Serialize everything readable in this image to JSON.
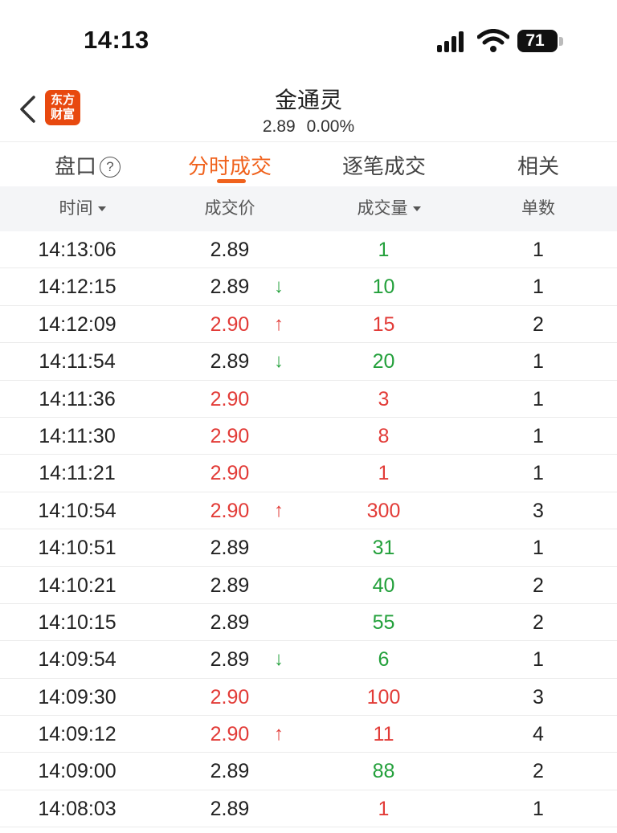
{
  "status_bar": {
    "time": "14:13",
    "battery": "71"
  },
  "header": {
    "stock_name": "金通灵",
    "price": "2.89",
    "change_pct": "0.00%",
    "logo_line1": "东方",
    "logo_line2": "财富"
  },
  "tabs": [
    {
      "label": "盘口",
      "active": false
    },
    {
      "label": "分时成交",
      "active": true
    },
    {
      "label": "逐笔成交",
      "active": false
    },
    {
      "label": "相关",
      "active": false
    }
  ],
  "columns": [
    "时间",
    "成交价",
    "成交量",
    "单数"
  ],
  "colors": {
    "up": "#e23b37",
    "down": "#23a03b",
    "accent": "#f0621d"
  },
  "trades": [
    {
      "time": "14:13:06",
      "price": "2.89",
      "price_color": "black",
      "arrow": "",
      "volume": "1",
      "volume_color": "green",
      "count": "1"
    },
    {
      "time": "14:12:15",
      "price": "2.89",
      "price_color": "black",
      "arrow": "↓",
      "volume": "10",
      "volume_color": "green",
      "count": "1"
    },
    {
      "time": "14:12:09",
      "price": "2.90",
      "price_color": "red",
      "arrow": "↑",
      "volume": "15",
      "volume_color": "red",
      "count": "2"
    },
    {
      "time": "14:11:54",
      "price": "2.89",
      "price_color": "black",
      "arrow": "↓",
      "volume": "20",
      "volume_color": "green",
      "count": "1"
    },
    {
      "time": "14:11:36",
      "price": "2.90",
      "price_color": "red",
      "arrow": "",
      "volume": "3",
      "volume_color": "red",
      "count": "1"
    },
    {
      "time": "14:11:30",
      "price": "2.90",
      "price_color": "red",
      "arrow": "",
      "volume": "8",
      "volume_color": "red",
      "count": "1"
    },
    {
      "time": "14:11:21",
      "price": "2.90",
      "price_color": "red",
      "arrow": "",
      "volume": "1",
      "volume_color": "red",
      "count": "1"
    },
    {
      "time": "14:10:54",
      "price": "2.90",
      "price_color": "red",
      "arrow": "↑",
      "volume": "300",
      "volume_color": "red",
      "count": "3"
    },
    {
      "time": "14:10:51",
      "price": "2.89",
      "price_color": "black",
      "arrow": "",
      "volume": "31",
      "volume_color": "green",
      "count": "1"
    },
    {
      "time": "14:10:21",
      "price": "2.89",
      "price_color": "black",
      "arrow": "",
      "volume": "40",
      "volume_color": "green",
      "count": "2"
    },
    {
      "time": "14:10:15",
      "price": "2.89",
      "price_color": "black",
      "arrow": "",
      "volume": "55",
      "volume_color": "green",
      "count": "2"
    },
    {
      "time": "14:09:54",
      "price": "2.89",
      "price_color": "black",
      "arrow": "↓",
      "volume": "6",
      "volume_color": "green",
      "count": "1"
    },
    {
      "time": "14:09:30",
      "price": "2.90",
      "price_color": "red",
      "arrow": "",
      "volume": "100",
      "volume_color": "red",
      "count": "3"
    },
    {
      "time": "14:09:12",
      "price": "2.90",
      "price_color": "red",
      "arrow": "↑",
      "volume": "11",
      "volume_color": "red",
      "count": "4"
    },
    {
      "time": "14:09:00",
      "price": "2.89",
      "price_color": "black",
      "arrow": "",
      "volume": "88",
      "volume_color": "green",
      "count": "2"
    },
    {
      "time": "14:08:03",
      "price": "2.89",
      "price_color": "black",
      "arrow": "",
      "volume": "1",
      "volume_color": "red",
      "count": "1"
    }
  ]
}
